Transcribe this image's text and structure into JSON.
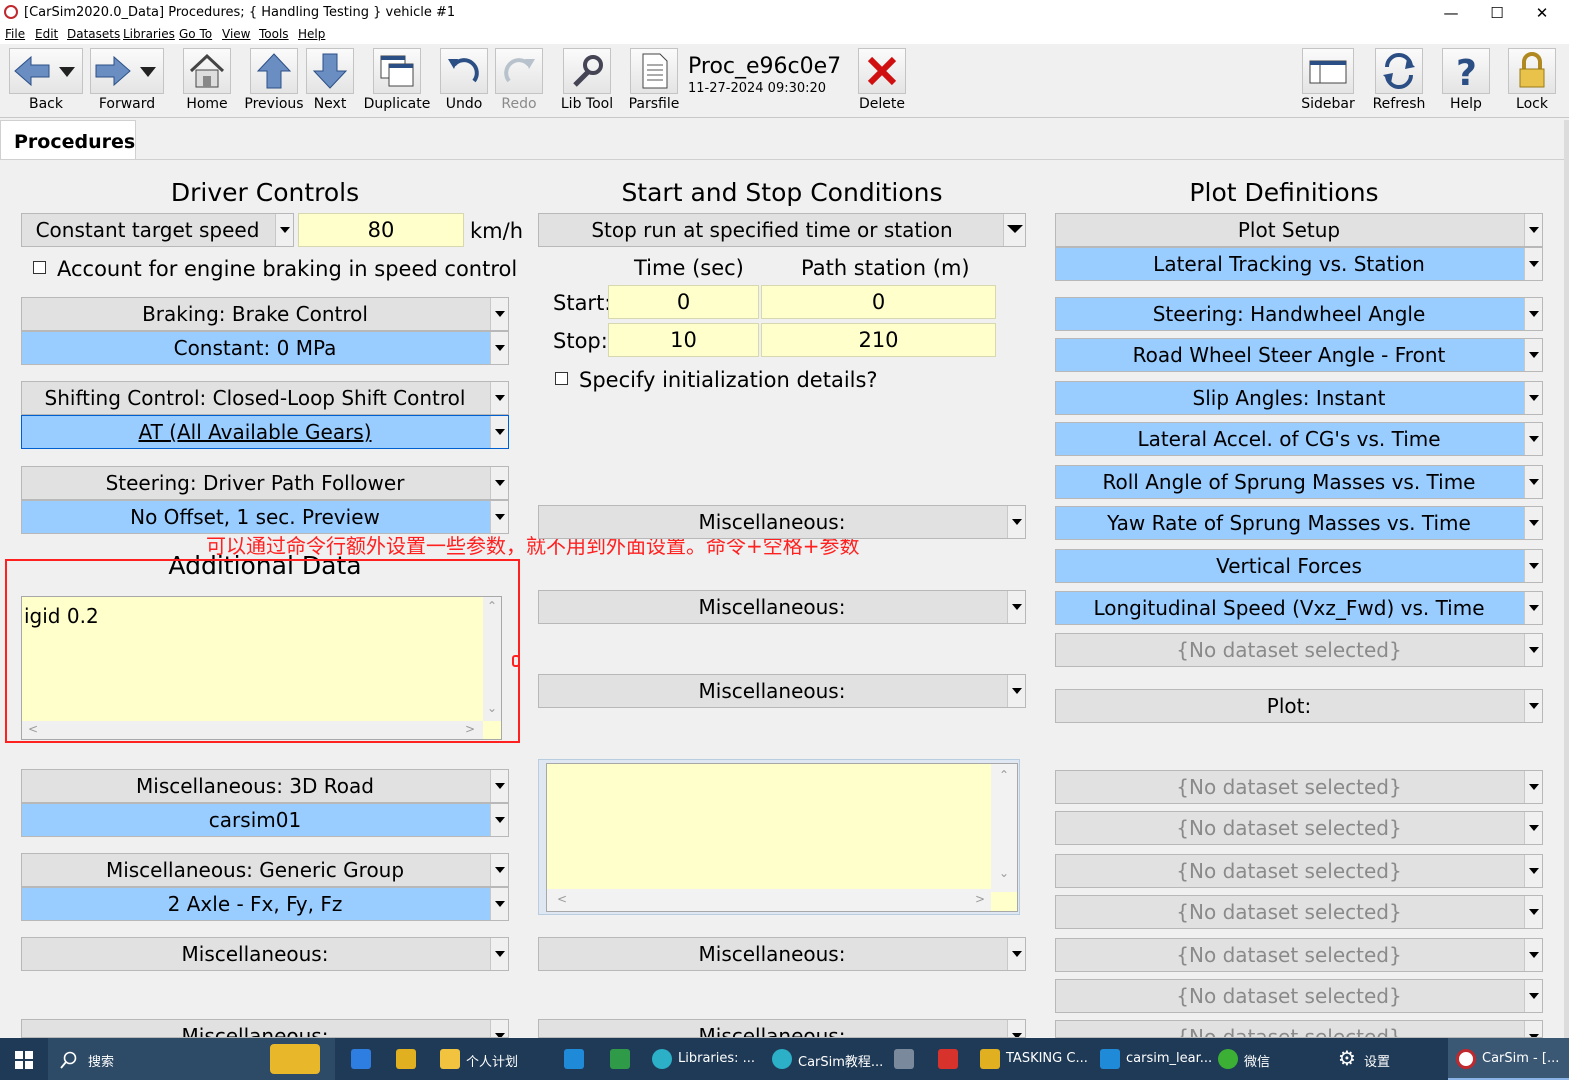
{
  "window": {
    "title": "[CarSim2020.0_Data] Procedures; { Handling Testing } vehicle #1"
  },
  "menu": [
    "File",
    "Edit",
    "Datasets",
    "Libraries",
    "Go To",
    "View",
    "Tools",
    "Help"
  ],
  "toolbar": {
    "back": "Back",
    "forward": "Forward",
    "home": "Home",
    "previous": "Previous",
    "next": "Next",
    "duplicate": "Duplicate",
    "undo": "Undo",
    "redo": "Redo",
    "lib_tool": "Lib Tool",
    "parsfile": "Parsfile",
    "dataset_name": "Proc_e96c0e7",
    "dataset_date": "11-27-2024 09:30:20",
    "delete": "Delete",
    "sidebar": "Sidebar",
    "refresh": "Refresh",
    "help": "Help",
    "lock": "Lock"
  },
  "tab": {
    "label": "Procedures"
  },
  "driver_controls": {
    "title": "Driver Controls",
    "speed_mode": "Constant target speed",
    "speed_value": "80",
    "speed_unit": "km/h",
    "engine_braking_label": "Account for engine braking in speed control",
    "braking_category": "Braking: Brake Control",
    "braking_dataset": "Constant: 0 MPa",
    "shifting_category": "Shifting Control: Closed-Loop Shift Control",
    "shifting_dataset": "AT (All Available Gears)",
    "steering_category": "Steering: Driver Path Follower",
    "steering_dataset": "No Offset, 1 sec. Preview"
  },
  "additional_data": {
    "title": "Additional Data",
    "text": "igid 0.2",
    "annotation": "可以通过命令行额外设置一些参数，就不用到外面设置。命令+空格+参数"
  },
  "left_lower": {
    "road_category": "Miscellaneous: 3D Road",
    "road_dataset": "carsim01",
    "generic_category": "Miscellaneous: Generic Group",
    "generic_dataset": "2 Axle - Fx, Fy, Fz",
    "misc1": "Miscellaneous:",
    "misc2": "Miscellaneous:"
  },
  "start_stop": {
    "title": "Start and Stop Conditions",
    "mode": "Stop run at specified time or station",
    "col_time": "Time (sec)",
    "col_station": "Path station (m)",
    "start_label": "Start:",
    "stop_label": "Stop:",
    "start_time": "0",
    "start_station": "0",
    "stop_time": "10",
    "stop_station": "210",
    "init_label": "Specify initialization details?",
    "misc1": "Miscellaneous:",
    "misc2": "Miscellaneous:",
    "misc3": "Miscellaneous:",
    "misc4": "Miscellaneous:",
    "misc5": "Miscellaneous:"
  },
  "plot_definitions": {
    "title": "Plot Definitions",
    "setup": "Plot Setup",
    "items": [
      "Lateral Tracking vs. Station",
      "Steering: Handwheel Angle",
      "Road Wheel Steer Angle - Front",
      "Slip Angles: Instant",
      "Lateral Accel. of CG's vs. Time",
      "Roll Angle of Sprung Masses vs. Time",
      "Yaw Rate of Sprung Masses vs. Time",
      "Vertical Forces",
      "Longitudinal Speed (Vxz_Fwd) vs. Time",
      "{No dataset selected}"
    ],
    "plot_label": "Plot:",
    "empty_items": [
      "{No dataset selected}",
      "{No dataset selected}",
      "{No dataset selected}",
      "{No dataset selected}",
      "{No dataset selected}",
      "{No dataset selected}",
      "{No dataset selected}"
    ]
  },
  "taskbar": {
    "search": "搜索",
    "items": [
      "个人计划",
      "Libraries: ...",
      "CarSim教程...",
      "TASKING C...",
      "carsim_lear...",
      "微信",
      "设置",
      "CarSim - [..."
    ]
  },
  "colors": {
    "field_yellow": "#ffffcc",
    "dataset_blue": "#99ccff",
    "annotation_red": "#ff2020"
  }
}
